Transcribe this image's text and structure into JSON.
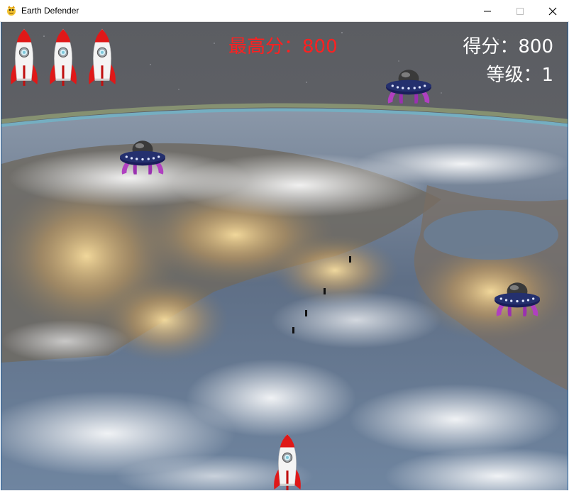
{
  "window": {
    "title": "Earth Defender",
    "icon": "pygame-snake-icon",
    "buttons": [
      "minimize-icon",
      "maximize-icon",
      "close-icon"
    ]
  },
  "hud": {
    "high_score_text": "最高分：800",
    "score_text": "得分：800",
    "level_text": "等级：1",
    "high_score_color": "#ff2020",
    "text_color": "#ffffff",
    "lives": 3
  },
  "sprites": {
    "life_icon": "rocket-icon",
    "player": "rocket-ship",
    "enemy": "ufo-saucer",
    "enemy_count": 3,
    "bullet_count": 4
  },
  "colors": {
    "space": "#4a4f58",
    "atmosphere": "#7fd0e8",
    "ocean": "#6d7f95",
    "city_lights": "#ffd27a",
    "rocket_red": "#e01818"
  }
}
